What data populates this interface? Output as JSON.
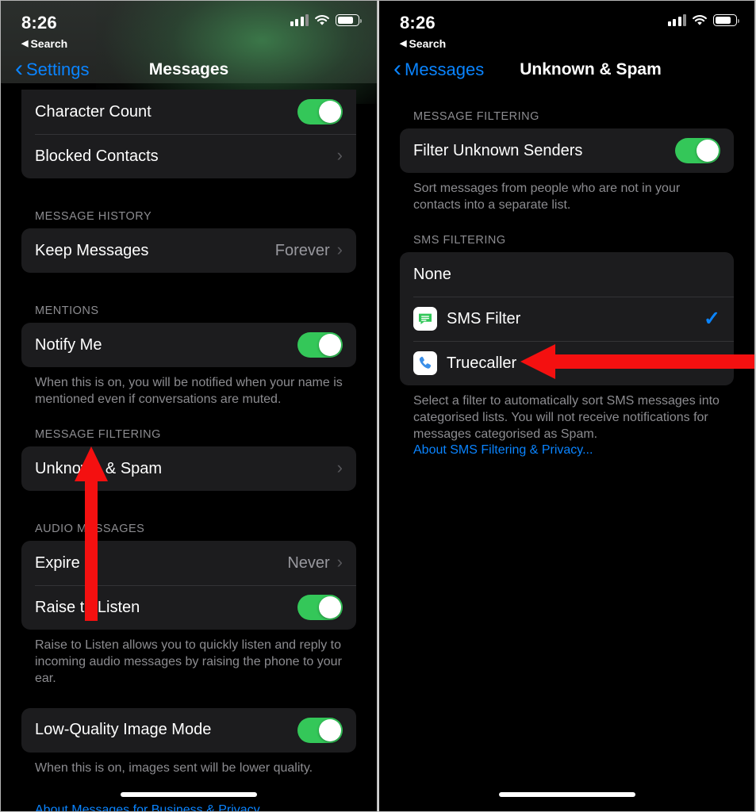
{
  "left_screen": {
    "status_bar": {
      "time": "8:26",
      "back_label": "Search",
      "back_icon": "triangle-left-icon",
      "signal_icon": "cellular-bars-icon",
      "wifi_icon": "wifi-icon",
      "battery_icon": "battery-icon"
    },
    "nav": {
      "back_label": "Settings",
      "title": "Messages",
      "back_icon": "chevron-left-icon"
    },
    "rows_top": [
      {
        "label": "Character Count",
        "type": "toggle",
        "state": "on"
      },
      {
        "label": "Blocked Contacts",
        "type": "disclosure"
      }
    ],
    "sections": [
      {
        "header": "MESSAGE HISTORY",
        "rows": [
          {
            "label": "Keep Messages",
            "type": "value",
            "value": "Forever"
          }
        ],
        "footer": ""
      },
      {
        "header": "MENTIONS",
        "rows": [
          {
            "label": "Notify Me",
            "type": "toggle",
            "state": "on"
          }
        ],
        "footer": "When this is on, you will be notified when your name is mentioned even if conversations are muted."
      },
      {
        "header": "MESSAGE FILTERING",
        "rows": [
          {
            "label": "Unknown & Spam",
            "type": "disclosure"
          }
        ],
        "footer": ""
      },
      {
        "header": "AUDIO MESSAGES",
        "rows": [
          {
            "label": "Expire",
            "type": "value",
            "value": "Never"
          },
          {
            "label": "Raise to Listen",
            "type": "toggle",
            "state": "on"
          }
        ],
        "footer": "Raise to Listen allows you to quickly listen and reply to incoming audio messages by raising the phone to your ear."
      },
      {
        "header": "",
        "rows": [
          {
            "label": "Low-Quality Image Mode",
            "type": "toggle",
            "state": "on"
          }
        ],
        "footer": "When this is on, images sent will be lower quality."
      }
    ],
    "bottom_link": "About Messages for Business & Privacy"
  },
  "right_screen": {
    "status_bar": {
      "time": "8:26",
      "back_label": "Search",
      "back_icon": "triangle-left-icon",
      "signal_icon": "cellular-bars-icon",
      "wifi_icon": "wifi-icon",
      "battery_icon": "battery-icon"
    },
    "nav": {
      "back_label": "Messages",
      "title": "Unknown & Spam",
      "back_icon": "chevron-left-icon"
    },
    "message_filtering": {
      "header": "MESSAGE FILTERING",
      "row_label": "Filter Unknown Senders",
      "toggle_state": "on",
      "footer": "Sort messages from people who are not in your contacts into a separate list."
    },
    "sms_filtering": {
      "header": "SMS FILTERING",
      "options": [
        {
          "label": "None",
          "icon": "",
          "selected": false
        },
        {
          "label": "SMS Filter",
          "icon": "sms-filter-app-icon",
          "selected": true
        },
        {
          "label": "Truecaller",
          "icon": "truecaller-app-icon",
          "selected": false
        }
      ],
      "footer": "Select a filter to automatically sort SMS messages into categorised lists. You will not receive notifications for messages categorised as Spam.",
      "link": "About SMS Filtering & Privacy..."
    }
  },
  "annotations": {
    "left_arrow_up": {
      "name": "red-arrow-up",
      "color": "#f41010",
      "points_to": "Unknown & Spam"
    },
    "right_arrow_left": {
      "name": "red-arrow-left",
      "color": "#f41010",
      "points_to": "Truecaller"
    }
  },
  "colors": {
    "accent_blue": "#0a84ff",
    "toggle_green": "#34c759",
    "annotation_red": "#f41010",
    "group_bg": "#1c1c1e",
    "screen_bg": "#000000"
  }
}
